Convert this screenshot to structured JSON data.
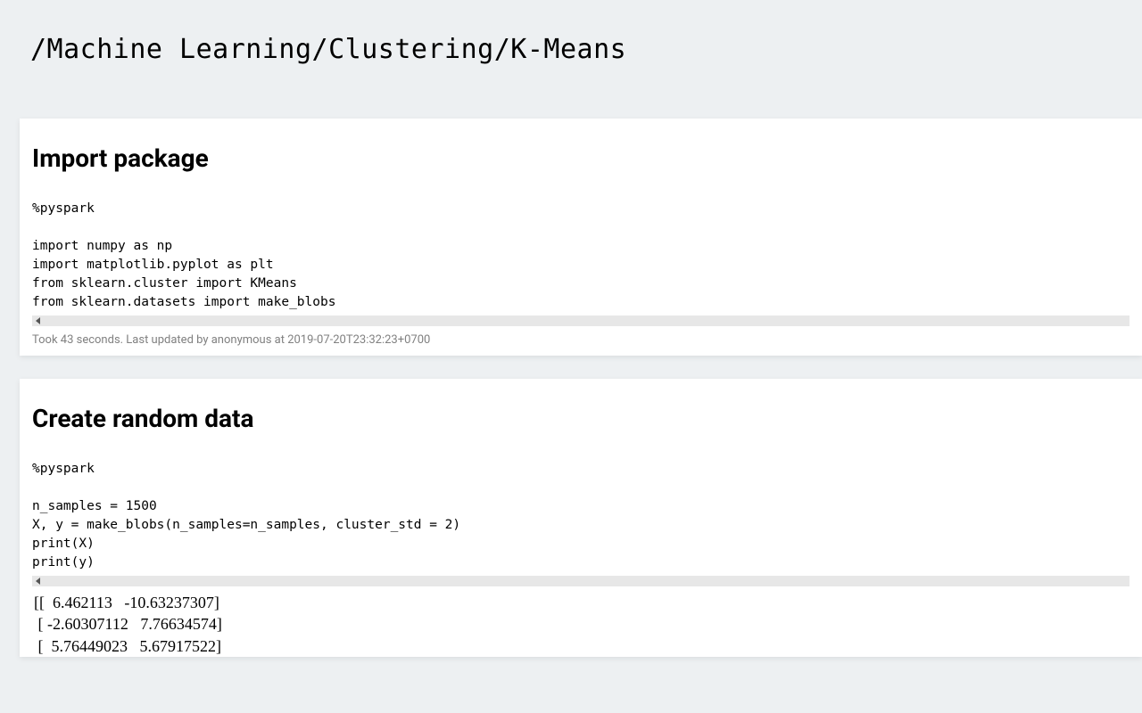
{
  "title": "/Machine Learning/Clustering/K-Means",
  "cells": {
    "cell1": {
      "heading": "Import package",
      "code": "%pyspark\n\nimport numpy as np\nimport matplotlib.pyplot as plt\nfrom sklearn.cluster import KMeans\nfrom sklearn.datasets import make_blobs",
      "status": "Took 43 seconds. Last updated by anonymous at 2019-07-20T23:32:23+0700"
    },
    "cell2": {
      "heading": "Create random data",
      "code": "%pyspark\n\nn_samples = 1500\nX, y = make_blobs(n_samples=n_samples, cluster_std = 2)\nprint(X)\nprint(y)",
      "output": "[[  6.462113   -10.63237307]\n [ -2.60307112   7.76634574]\n [  5.76449023   5.67917522]"
    }
  }
}
